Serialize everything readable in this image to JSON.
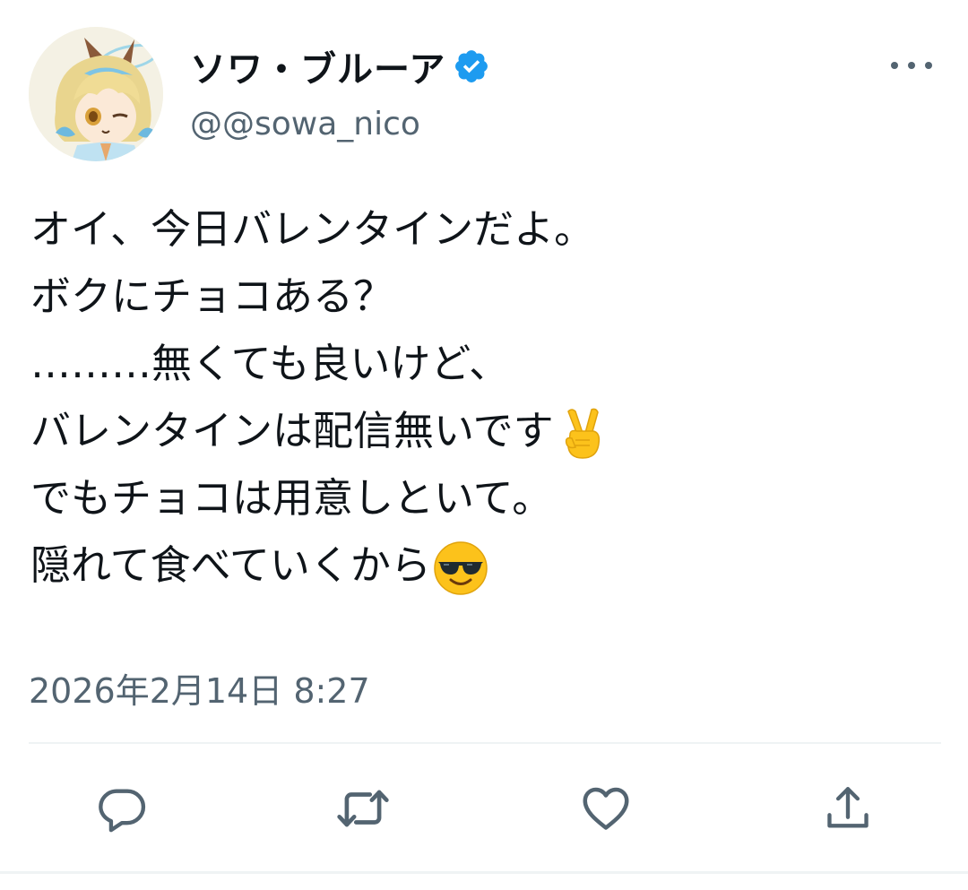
{
  "tweet": {
    "display_name": "ソワ・ブルーア",
    "handle": "@@sowa_nico",
    "text_lines": [
      "オイ、今日バレンタインだよ。",
      "ボクにチョコある？",
      "………無くても良いけど、",
      "バレンタインは配信無いです",
      "でもチョコは用意しといて。",
      "隠れて食べていくから"
    ],
    "line_emojis": {
      "3": "victory-hand-emoji",
      "5": "sunglasses-face-emoji"
    },
    "timestamp": "2026年2月14日 8:27"
  },
  "icons": {
    "verified": "verified-badge-icon",
    "more": "more-options-icon",
    "reply": "reply-icon",
    "retweet": "retweet-icon",
    "like": "like-icon",
    "share": "share-icon"
  },
  "colors": {
    "text": "#0f1419",
    "secondary_text": "#536471",
    "verified_blue": "#1d9bf0",
    "divider": "#eff3f4"
  }
}
